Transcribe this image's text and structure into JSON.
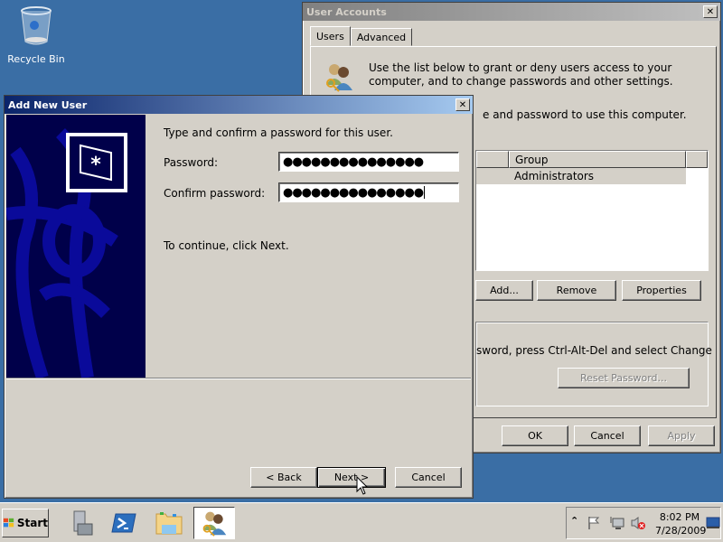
{
  "desktop": {
    "recycle_bin_label": "Recycle Bin"
  },
  "user_accounts": {
    "title": "User Accounts",
    "tabs": [
      {
        "label": "Users",
        "selected": true
      },
      {
        "label": "Advanced",
        "selected": false
      }
    ],
    "intro_text": "Use the list below to grant or deny users access to your computer, and to change passwords and other settings.",
    "users_text_partial": "e and password to use this computer.",
    "list": {
      "columns": [
        "",
        "Group"
      ],
      "rows": [
        {
          "group": "Administrators"
        }
      ]
    },
    "buttons": {
      "add": "Add...",
      "remove": "Remove",
      "properties": "Properties"
    },
    "password_group_text_partial": "sword, press Ctrl-Alt-Del and select Change",
    "reset_password": "Reset Password...",
    "footer": {
      "ok": "OK",
      "cancel": "Cancel",
      "apply": "Apply"
    }
  },
  "add_new_user": {
    "title": "Add New User",
    "instruction": "Type and confirm a password for this user.",
    "password_label": "Password:",
    "password_value": "●●●●●●●●●●●●●●●",
    "confirm_label": "Confirm password:",
    "confirm_value": "●●●●●●●●●●●●●●●",
    "continue_text": "To continue, click Next.",
    "buttons": {
      "back": "< Back",
      "next": "Next >",
      "cancel": "Cancel"
    }
  },
  "taskbar": {
    "start_label": "Start",
    "apps": [
      "server-manager",
      "powershell",
      "windows-explorer",
      "user-accounts"
    ],
    "clock_time": "8:02 PM",
    "clock_date": "7/28/2009"
  }
}
